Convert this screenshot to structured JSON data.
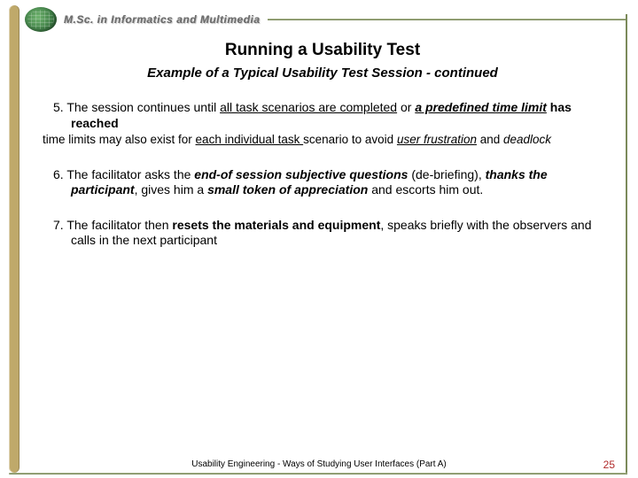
{
  "header": {
    "program": "M.Sc. in Informatics and Multimedia"
  },
  "slide": {
    "title": "Running a Usability Test",
    "subtitle": "Example of a Typical Usability Test Session - continued"
  },
  "points": {
    "p5": {
      "num": "5.",
      "t1": "The session continues until ",
      "t2": "all task scenarios are completed",
      "t3": " or ",
      "t4": "a predefined time limit",
      "t5": " has reached"
    },
    "p5note": {
      "t1": "time limits may also exist for ",
      "t2": "each individual task ",
      "t3": "scenario to avoid ",
      "t4": "user frustration",
      "t5": " and ",
      "t6": "deadlock"
    },
    "p6": {
      "num": "6.",
      "t1": "The facilitator asks the ",
      "t2": "end-of session subjective questions",
      "t3": " (de-briefing), ",
      "t4": "thanks the participant",
      "t5": ", gives him a ",
      "t6": "small token of appreciation",
      "t7": " and escorts him out."
    },
    "p7": {
      "num": "7.",
      "t1": "The facilitator then ",
      "t2": "resets the materials and equipment",
      "t3": ", speaks briefly with the observers and calls in the next participant"
    }
  },
  "footer": {
    "text": "Usability Engineering  -  Ways of Studying User Interfaces (Part A)",
    "page": "25"
  }
}
